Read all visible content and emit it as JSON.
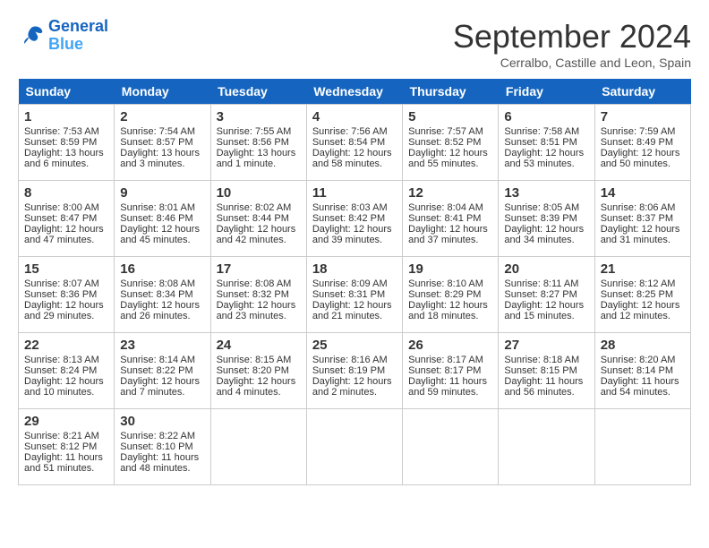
{
  "logo": {
    "line1": "General",
    "line2": "Blue"
  },
  "title": "September 2024",
  "subtitle": "Cerralbo, Castille and Leon, Spain",
  "days_header": [
    "Sunday",
    "Monday",
    "Tuesday",
    "Wednesday",
    "Thursday",
    "Friday",
    "Saturday"
  ],
  "weeks": [
    [
      {
        "day": "1",
        "lines": [
          "Sunrise: 7:53 AM",
          "Sunset: 8:59 PM",
          "Daylight: 13 hours",
          "and 6 minutes."
        ]
      },
      {
        "day": "2",
        "lines": [
          "Sunrise: 7:54 AM",
          "Sunset: 8:57 PM",
          "Daylight: 13 hours",
          "and 3 minutes."
        ]
      },
      {
        "day": "3",
        "lines": [
          "Sunrise: 7:55 AM",
          "Sunset: 8:56 PM",
          "Daylight: 13 hours",
          "and 1 minute."
        ]
      },
      {
        "day": "4",
        "lines": [
          "Sunrise: 7:56 AM",
          "Sunset: 8:54 PM",
          "Daylight: 12 hours",
          "and 58 minutes."
        ]
      },
      {
        "day": "5",
        "lines": [
          "Sunrise: 7:57 AM",
          "Sunset: 8:52 PM",
          "Daylight: 12 hours",
          "and 55 minutes."
        ]
      },
      {
        "day": "6",
        "lines": [
          "Sunrise: 7:58 AM",
          "Sunset: 8:51 PM",
          "Daylight: 12 hours",
          "and 53 minutes."
        ]
      },
      {
        "day": "7",
        "lines": [
          "Sunrise: 7:59 AM",
          "Sunset: 8:49 PM",
          "Daylight: 12 hours",
          "and 50 minutes."
        ]
      }
    ],
    [
      {
        "day": "8",
        "lines": [
          "Sunrise: 8:00 AM",
          "Sunset: 8:47 PM",
          "Daylight: 12 hours",
          "and 47 minutes."
        ]
      },
      {
        "day": "9",
        "lines": [
          "Sunrise: 8:01 AM",
          "Sunset: 8:46 PM",
          "Daylight: 12 hours",
          "and 45 minutes."
        ]
      },
      {
        "day": "10",
        "lines": [
          "Sunrise: 8:02 AM",
          "Sunset: 8:44 PM",
          "Daylight: 12 hours",
          "and 42 minutes."
        ]
      },
      {
        "day": "11",
        "lines": [
          "Sunrise: 8:03 AM",
          "Sunset: 8:42 PM",
          "Daylight: 12 hours",
          "and 39 minutes."
        ]
      },
      {
        "day": "12",
        "lines": [
          "Sunrise: 8:04 AM",
          "Sunset: 8:41 PM",
          "Daylight: 12 hours",
          "and 37 minutes."
        ]
      },
      {
        "day": "13",
        "lines": [
          "Sunrise: 8:05 AM",
          "Sunset: 8:39 PM",
          "Daylight: 12 hours",
          "and 34 minutes."
        ]
      },
      {
        "day": "14",
        "lines": [
          "Sunrise: 8:06 AM",
          "Sunset: 8:37 PM",
          "Daylight: 12 hours",
          "and 31 minutes."
        ]
      }
    ],
    [
      {
        "day": "15",
        "lines": [
          "Sunrise: 8:07 AM",
          "Sunset: 8:36 PM",
          "Daylight: 12 hours",
          "and 29 minutes."
        ]
      },
      {
        "day": "16",
        "lines": [
          "Sunrise: 8:08 AM",
          "Sunset: 8:34 PM",
          "Daylight: 12 hours",
          "and 26 minutes."
        ]
      },
      {
        "day": "17",
        "lines": [
          "Sunrise: 8:08 AM",
          "Sunset: 8:32 PM",
          "Daylight: 12 hours",
          "and 23 minutes."
        ]
      },
      {
        "day": "18",
        "lines": [
          "Sunrise: 8:09 AM",
          "Sunset: 8:31 PM",
          "Daylight: 12 hours",
          "and 21 minutes."
        ]
      },
      {
        "day": "19",
        "lines": [
          "Sunrise: 8:10 AM",
          "Sunset: 8:29 PM",
          "Daylight: 12 hours",
          "and 18 minutes."
        ]
      },
      {
        "day": "20",
        "lines": [
          "Sunrise: 8:11 AM",
          "Sunset: 8:27 PM",
          "Daylight: 12 hours",
          "and 15 minutes."
        ]
      },
      {
        "day": "21",
        "lines": [
          "Sunrise: 8:12 AM",
          "Sunset: 8:25 PM",
          "Daylight: 12 hours",
          "and 12 minutes."
        ]
      }
    ],
    [
      {
        "day": "22",
        "lines": [
          "Sunrise: 8:13 AM",
          "Sunset: 8:24 PM",
          "Daylight: 12 hours",
          "and 10 minutes."
        ]
      },
      {
        "day": "23",
        "lines": [
          "Sunrise: 8:14 AM",
          "Sunset: 8:22 PM",
          "Daylight: 12 hours",
          "and 7 minutes."
        ]
      },
      {
        "day": "24",
        "lines": [
          "Sunrise: 8:15 AM",
          "Sunset: 8:20 PM",
          "Daylight: 12 hours",
          "and 4 minutes."
        ]
      },
      {
        "day": "25",
        "lines": [
          "Sunrise: 8:16 AM",
          "Sunset: 8:19 PM",
          "Daylight: 12 hours",
          "and 2 minutes."
        ]
      },
      {
        "day": "26",
        "lines": [
          "Sunrise: 8:17 AM",
          "Sunset: 8:17 PM",
          "Daylight: 11 hours",
          "and 59 minutes."
        ]
      },
      {
        "day": "27",
        "lines": [
          "Sunrise: 8:18 AM",
          "Sunset: 8:15 PM",
          "Daylight: 11 hours",
          "and 56 minutes."
        ]
      },
      {
        "day": "28",
        "lines": [
          "Sunrise: 8:20 AM",
          "Sunset: 8:14 PM",
          "Daylight: 11 hours",
          "and 54 minutes."
        ]
      }
    ],
    [
      {
        "day": "29",
        "lines": [
          "Sunrise: 8:21 AM",
          "Sunset: 8:12 PM",
          "Daylight: 11 hours",
          "and 51 minutes."
        ]
      },
      {
        "day": "30",
        "lines": [
          "Sunrise: 8:22 AM",
          "Sunset: 8:10 PM",
          "Daylight: 11 hours",
          "and 48 minutes."
        ]
      },
      {
        "day": "",
        "lines": []
      },
      {
        "day": "",
        "lines": []
      },
      {
        "day": "",
        "lines": []
      },
      {
        "day": "",
        "lines": []
      },
      {
        "day": "",
        "lines": []
      }
    ]
  ]
}
